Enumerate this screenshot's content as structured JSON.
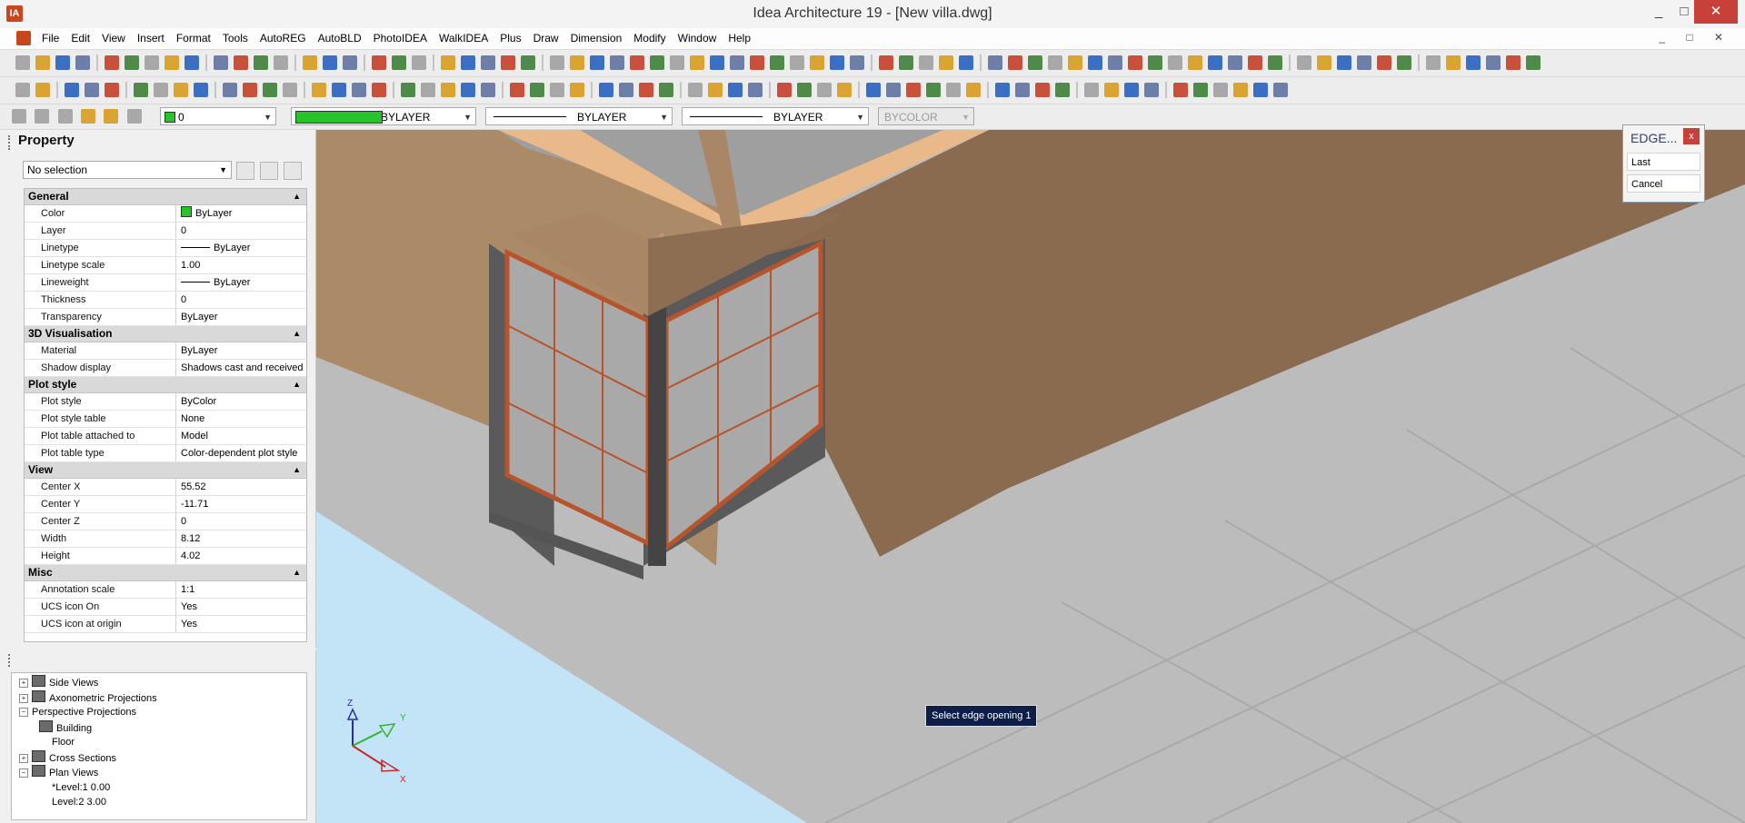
{
  "window": {
    "title": "Idea Architecture 19 - [New villa.dwg]",
    "app_icon_letter": "IA",
    "minimize": "_",
    "maximize": "□",
    "close": "✕"
  },
  "menu": {
    "items": [
      "File",
      "Edit",
      "View",
      "Insert",
      "Format",
      "Tools",
      "AutoREG",
      "AutoBLD",
      "PhotoIDEA",
      "WalkIDEA",
      "Plus",
      "Draw",
      "Dimension",
      "Modify",
      "Window",
      "Help"
    ],
    "mdi_controls": "_ □ ✕"
  },
  "property_toolbar": {
    "layer_value": "0",
    "color_value": "BYLAYER",
    "linetype_value": "BYLAYER",
    "lineweight_value": "BYLAYER",
    "plotstyle_value": "BYCOLOR",
    "accent_green": "#27c32b"
  },
  "property_panel": {
    "title": "Property",
    "selection": "No selection",
    "categories": [
      {
        "name": "General",
        "rows": [
          {
            "key": "Color",
            "value": "ByLayer",
            "swatch": true
          },
          {
            "key": "Layer",
            "value": "0"
          },
          {
            "key": "Linetype",
            "value": "ByLayer",
            "line": true
          },
          {
            "key": "Linetype scale",
            "value": "1.00"
          },
          {
            "key": "Lineweight",
            "value": "ByLayer",
            "line": true
          },
          {
            "key": "Thickness",
            "value": "0"
          },
          {
            "key": "Transparency",
            "value": "ByLayer"
          }
        ]
      },
      {
        "name": "3D Visualisation",
        "rows": [
          {
            "key": "Material",
            "value": "ByLayer"
          },
          {
            "key": "Shadow display",
            "value": "Shadows cast and received"
          }
        ]
      },
      {
        "name": "Plot style",
        "rows": [
          {
            "key": "Plot style",
            "value": "ByColor"
          },
          {
            "key": "Plot style table",
            "value": "None"
          },
          {
            "key": "Plot table attached to",
            "value": "Model"
          },
          {
            "key": "Plot table type",
            "value": "Color-dependent plot style"
          }
        ]
      },
      {
        "name": "View",
        "rows": [
          {
            "key": "Center X",
            "value": "55.52"
          },
          {
            "key": "Center Y",
            "value": "-11.71"
          },
          {
            "key": "Center Z",
            "value": "0"
          },
          {
            "key": "Width",
            "value": "8.12"
          },
          {
            "key": "Height",
            "value": "4.02"
          }
        ]
      },
      {
        "name": "Misc",
        "rows": [
          {
            "key": "Annotation scale",
            "value": "1:1"
          },
          {
            "key": "UCS icon On",
            "value": "Yes"
          },
          {
            "key": "UCS icon at origin",
            "value": "Yes"
          }
        ]
      }
    ]
  },
  "explorer": {
    "nodes": [
      {
        "label": "Side Views",
        "expander": "+",
        "icon": true
      },
      {
        "label": "Axonometric Projections",
        "expander": "+",
        "icon": true
      },
      {
        "label": "Perspective Projections",
        "expander": "−",
        "icon": false
      },
      {
        "label": "Building",
        "expander": "",
        "icon": true
      },
      {
        "label": "Floor",
        "expander": "",
        "icon": false
      },
      {
        "label": "Cross Sections",
        "expander": "+",
        "icon": true
      },
      {
        "label": "Plan Views",
        "expander": "−",
        "icon": true
      },
      {
        "label": "*Level:1  0.00",
        "expander": "",
        "icon": false
      },
      {
        "label": "Level:2  3.00",
        "expander": "",
        "icon": false
      }
    ]
  },
  "edge_dialog": {
    "title": "EDGE...",
    "close": "x",
    "options": [
      "Last",
      "Cancel"
    ]
  },
  "viewport": {
    "prompt_tooltip": "Select edge opening 1",
    "ucs_labels": {
      "z": "Z",
      "y": "Y",
      "x": "X"
    }
  }
}
